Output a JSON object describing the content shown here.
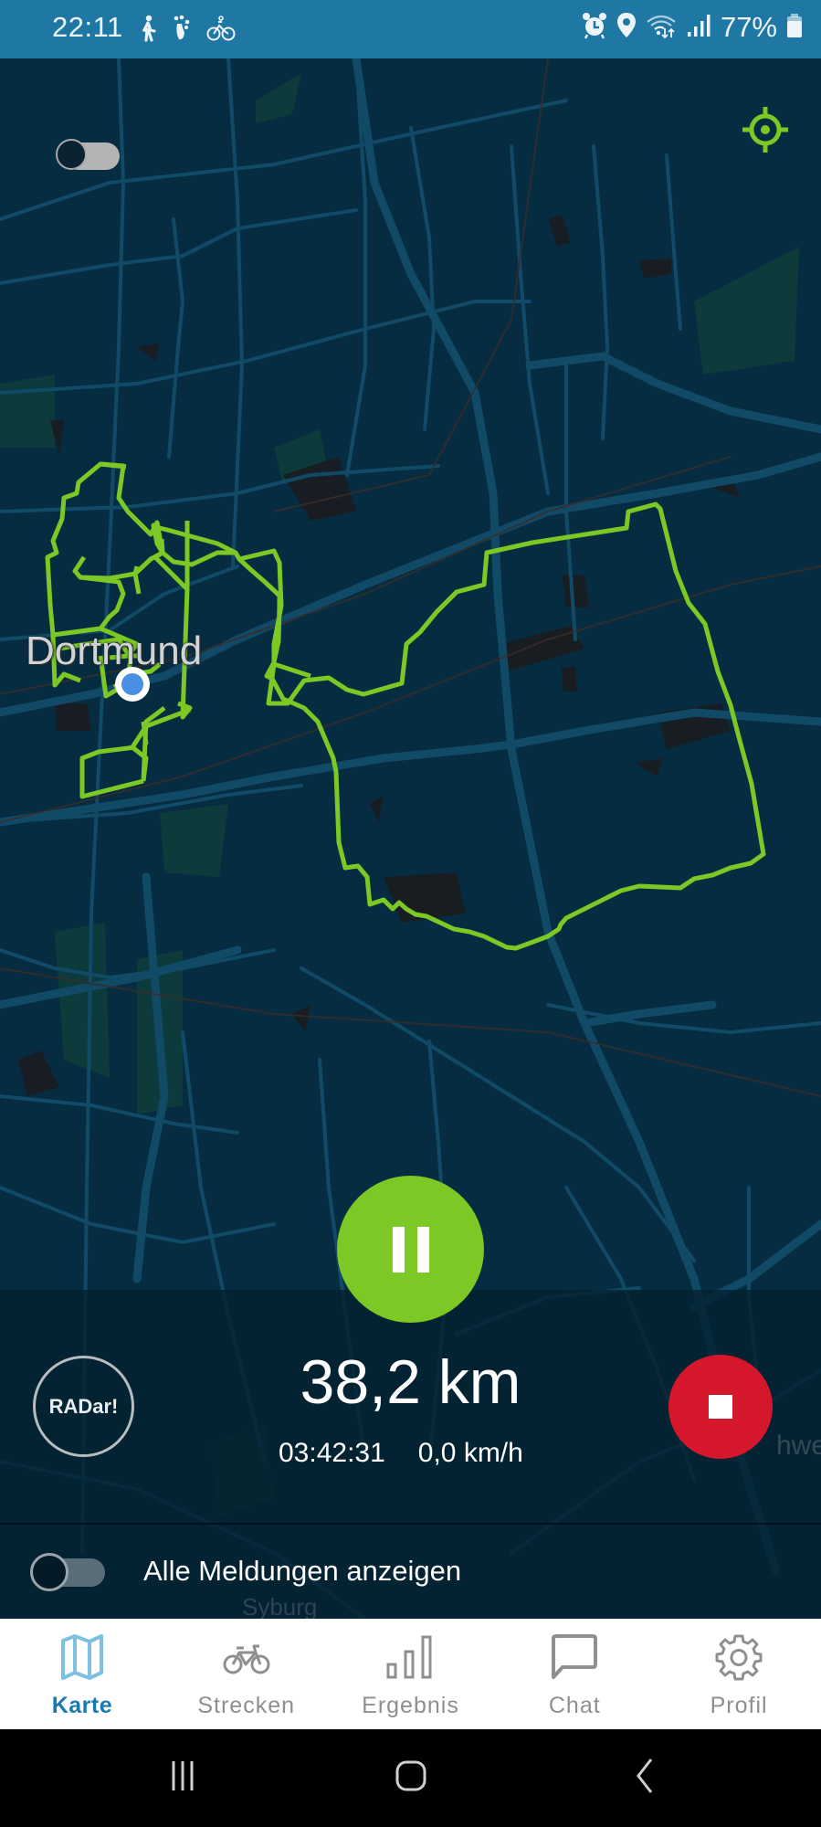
{
  "status_bar": {
    "time": "22:11",
    "left_icons": [
      "walking-icon",
      "footsteps-icon",
      "cycling-icon"
    ],
    "right_icons": [
      "alarm-icon",
      "location-icon",
      "wifi-icon",
      "signal-icon"
    ],
    "battery_percent": "77%"
  },
  "map": {
    "city_label": "Dortmund",
    "place_labels": [
      "Syburg",
      "hwe"
    ],
    "route_color": "#7cc825",
    "current_position_color": "#4a90e2"
  },
  "controls": {
    "night_mode_toggle": {
      "state": "on",
      "icon": "moon-icon"
    },
    "locate_icon": "crosshair-icon",
    "pause_icon": "pause-icon",
    "stop_icon": "stop-icon",
    "radar_label": "RADar!"
  },
  "stats": {
    "distance": "38,2 km",
    "duration": "03:42:31",
    "speed": "0,0 km/h"
  },
  "messages": {
    "toggle_state": "off",
    "label": "Alle Meldungen anzeigen"
  },
  "bottom_nav": {
    "active_index": 0,
    "accent_color": "#1a7ab0",
    "items": [
      {
        "label": "Karte",
        "icon": "map-icon"
      },
      {
        "label": "Strecken",
        "icon": "bicycle-icon"
      },
      {
        "label": "Ergebnis",
        "icon": "bar-chart-icon"
      },
      {
        "label": "Chat",
        "icon": "chat-icon"
      },
      {
        "label": "Profil",
        "icon": "gear-icon"
      }
    ]
  },
  "system_nav": {
    "buttons": [
      "recent-apps",
      "home",
      "back"
    ]
  }
}
